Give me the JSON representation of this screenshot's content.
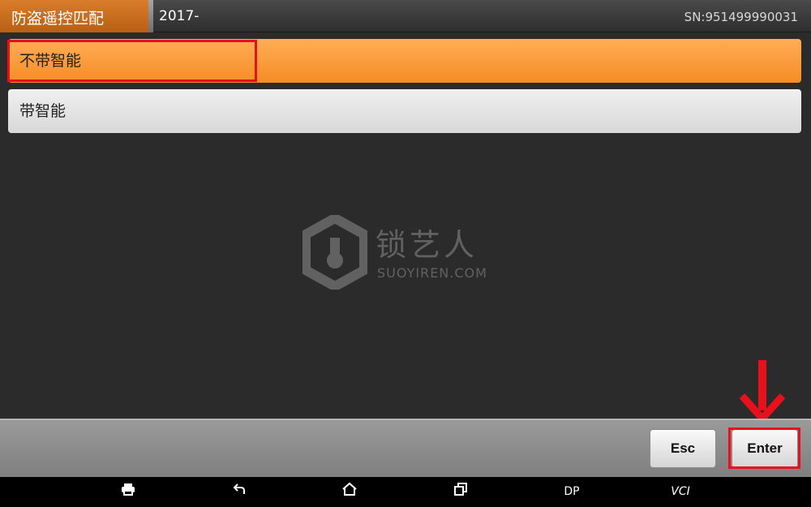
{
  "header": {
    "title": "防盗遥控匹配",
    "subtitle": "2017-",
    "serial": "SN:951499990031"
  },
  "menu": {
    "items": [
      {
        "label": "不带智能",
        "selected": true
      },
      {
        "label": "带智能",
        "selected": false
      }
    ]
  },
  "watermark": {
    "brand": "锁艺人",
    "domain": "SUOYIREN.COM"
  },
  "actions": {
    "esc_label": "Esc",
    "enter_label": "Enter"
  },
  "navbar": {
    "dp_label": "DP",
    "vci_label": "VCI"
  },
  "colors": {
    "accent": "#f58d25",
    "highlight": "#e8101a"
  }
}
